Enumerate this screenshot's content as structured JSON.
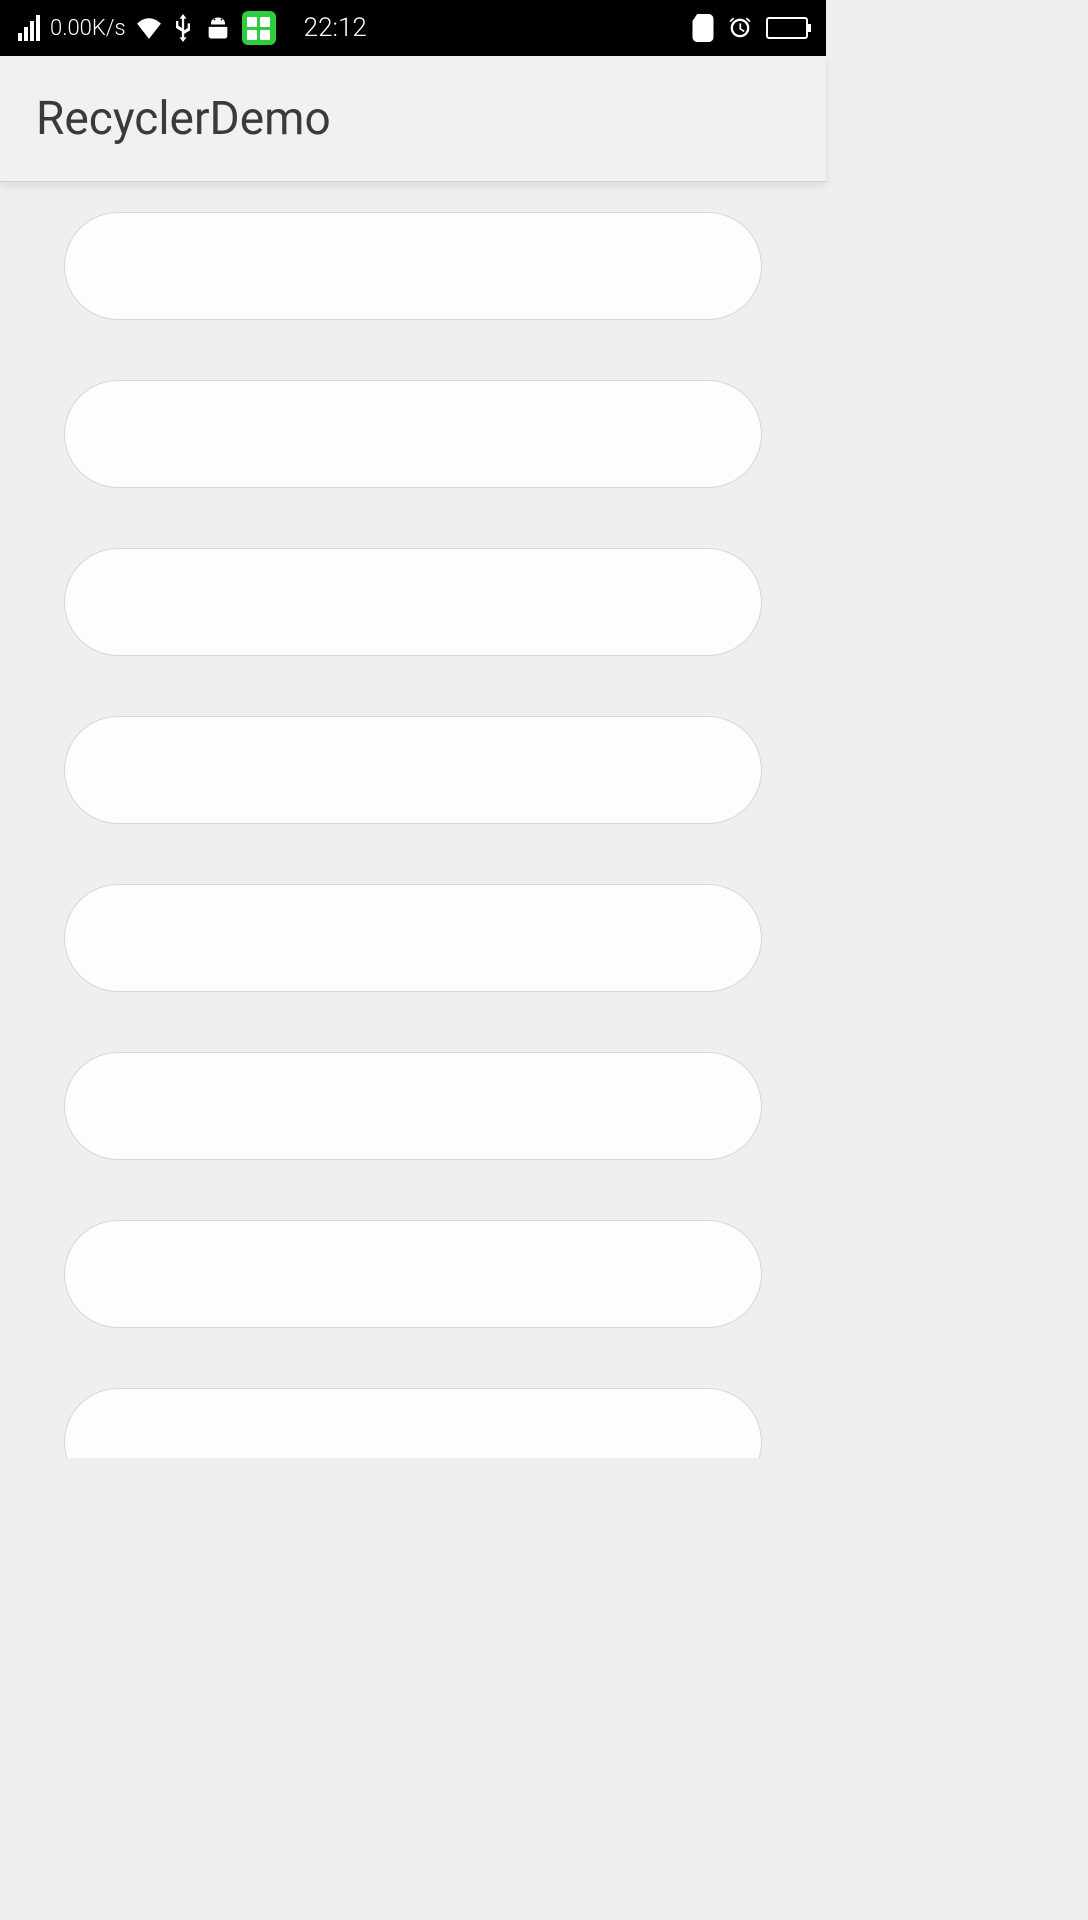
{
  "status_bar": {
    "network_speed": "0.00K/s",
    "time": "22:12",
    "icons": {
      "signal": "cell-signal-icon",
      "wifi": "wifi-icon",
      "usb": "usb-icon",
      "android": "android-debug-icon",
      "apps_tile": "apps-tile-icon",
      "sim": "sim-card-icon",
      "alarm": "alarm-icon",
      "battery": "battery-icon"
    }
  },
  "app_bar": {
    "title": "RecyclerDemo"
  },
  "list": {
    "items": [
      {
        "label": ""
      },
      {
        "label": ""
      },
      {
        "label": ""
      },
      {
        "label": ""
      },
      {
        "label": ""
      },
      {
        "label": ""
      },
      {
        "label": ""
      },
      {
        "label": ""
      }
    ]
  }
}
